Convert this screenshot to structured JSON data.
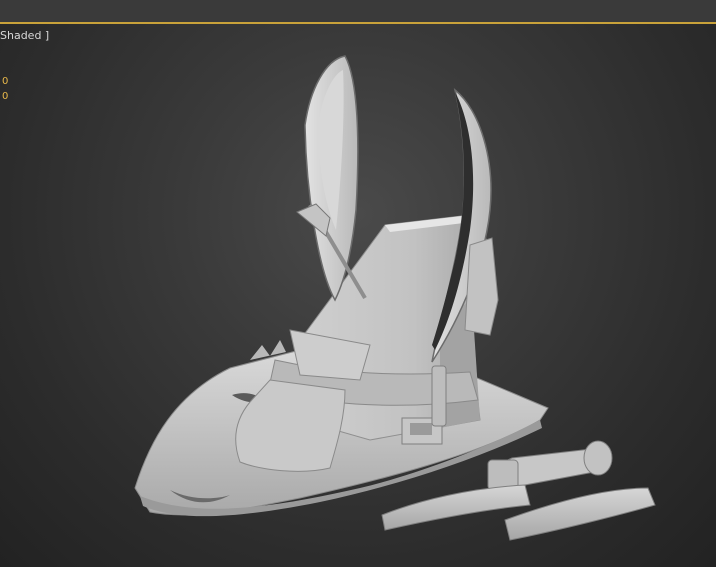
{
  "viewport": {
    "label": "Shaded ]",
    "stats": [
      "0",
      "0"
    ]
  },
  "colors": {
    "accent_line": "#c9a23a",
    "stats_text": "#e8b84a",
    "model_base": "#c8c8c8"
  },
  "model": {
    "name": "hat-model-icon"
  }
}
